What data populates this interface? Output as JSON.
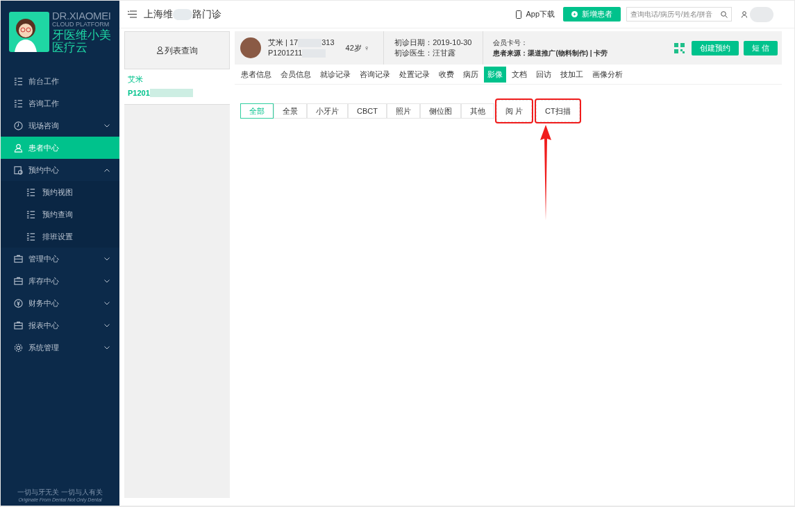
{
  "logo": {
    "title": "DR.XIAOMEI",
    "subtitle": "CLOUD PLATFORM",
    "name_line1": "牙医维小美",
    "name_line2": "医疗云"
  },
  "sidebar": {
    "items": [
      {
        "label": "前台工作",
        "selected": false
      },
      {
        "label": "咨询工作",
        "selected": false
      },
      {
        "label": "现场咨询",
        "selected": false,
        "expanded": false
      },
      {
        "label": "患者中心",
        "selected": true
      },
      {
        "label": "预约中心",
        "selected": false,
        "expanded": true,
        "children": [
          {
            "label": "预约视图",
            "selected": false
          },
          {
            "label": "预约查询",
            "selected": false
          },
          {
            "label": "排班设置",
            "selected": false
          }
        ]
      },
      {
        "label": "管理中心",
        "selected": false,
        "expanded": false
      },
      {
        "label": "库存中心",
        "selected": false,
        "expanded": false
      },
      {
        "label": "财务中心",
        "selected": false,
        "expanded": false
      },
      {
        "label": "报表中心",
        "selected": false,
        "expanded": false
      },
      {
        "label": "系统管理",
        "selected": false,
        "expanded": false
      }
    ],
    "footer_line1": "一切与牙无关 一切与人有关",
    "footer_line2": "Originate From Dental Not Only Dental"
  },
  "topbar": {
    "clinic_start": "上海维",
    "clinic_end": "路门诊",
    "app_download": "App下载",
    "new_patient": "新增患者",
    "search_placeholder": "查询电话/病历号/姓名/拼音"
  },
  "list_panel": {
    "query_button": "列表查询",
    "patients": [
      {
        "name": "艾米",
        "id": "P1201"
      }
    ]
  },
  "patient": {
    "name_phone": "艾米 | 17",
    "phone_end": "313",
    "id": "P1201211",
    "age_sex": "42岁 ♀",
    "first_visit": "初诊日期：2019-10-30",
    "doctor": "初诊医生：汪甘露",
    "card": "会员卡号：",
    "source": "患者来源：渠道推广(物料制作) | 卡劳",
    "create_appointment": "创建预约",
    "sms": "短 信"
  },
  "tabs": [
    {
      "label": "患者信息",
      "selected": false
    },
    {
      "label": "会员信息",
      "selected": false
    },
    {
      "label": "就诊记录",
      "selected": false
    },
    {
      "label": "咨询记录",
      "selected": false
    },
    {
      "label": "处置记录",
      "selected": false
    },
    {
      "label": "收费",
      "selected": false
    },
    {
      "label": "病历",
      "selected": false
    },
    {
      "label": "影像",
      "selected": true
    },
    {
      "label": "文档",
      "selected": false
    },
    {
      "label": "回访",
      "selected": false
    },
    {
      "label": "技加工",
      "selected": false
    },
    {
      "label": "画像分析",
      "selected": false
    }
  ],
  "image_filters": [
    {
      "label": "全部",
      "selected": true,
      "highlighted": false
    },
    {
      "label": "全景",
      "selected": false,
      "highlighted": false
    },
    {
      "label": "小牙片",
      "selected": false,
      "highlighted": false
    },
    {
      "label": "CBCT",
      "selected": false,
      "highlighted": false
    },
    {
      "label": "照片",
      "selected": false,
      "highlighted": false
    },
    {
      "label": "侧位图",
      "selected": false,
      "highlighted": false
    },
    {
      "label": "其他",
      "selected": false,
      "highlighted": false
    },
    {
      "label": "阅 片",
      "selected": false,
      "highlighted": true
    },
    {
      "label": "CT扫描",
      "selected": false,
      "highlighted": true
    }
  ]
}
